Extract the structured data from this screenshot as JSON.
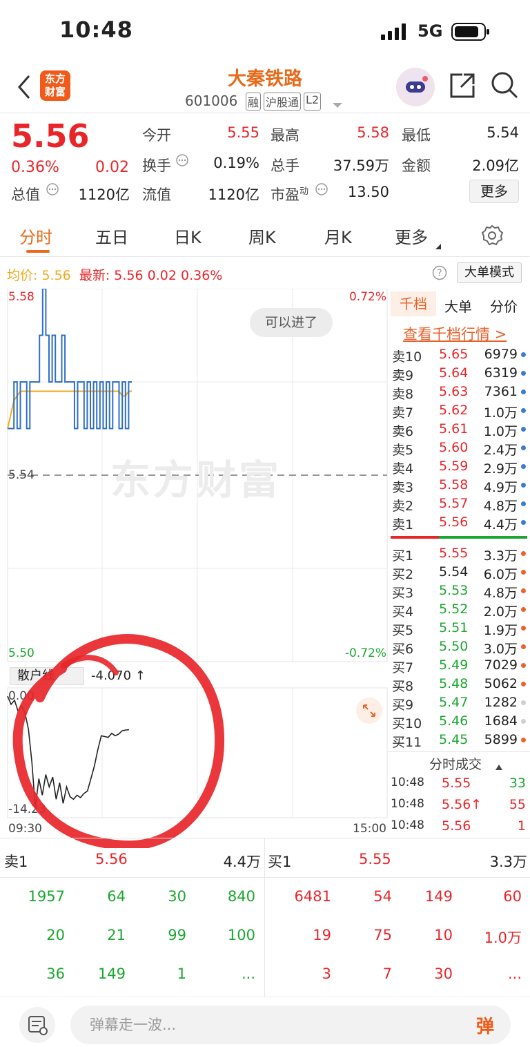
{
  "status": {
    "time": "10:48",
    "network": "5G"
  },
  "header": {
    "title": "大秦铁路",
    "code": "601006",
    "badges": [
      "融",
      "沪股通",
      "L2"
    ],
    "logo_text": "东方财富"
  },
  "quote": {
    "price": "5.56",
    "change_pct": "0.36%",
    "change": "0.02",
    "fields": [
      {
        "label": "今开",
        "value": "5.55"
      },
      {
        "label": "最高",
        "value": "5.58"
      },
      {
        "label": "最低",
        "value": "5.54"
      },
      {
        "label": "换手",
        "value": "0.19%"
      },
      {
        "label": "总手",
        "value": "37.59万"
      },
      {
        "label": "金额",
        "value": "2.09亿"
      },
      {
        "label": "总值",
        "value": "1120亿"
      },
      {
        "label": "流值",
        "value": "1120亿"
      },
      {
        "label": "市盈",
        "label_sup": "动",
        "value": "13.50"
      }
    ],
    "more_button": "更多"
  },
  "tabs": [
    "分时",
    "五日",
    "日K",
    "周K",
    "月K",
    "更多"
  ],
  "infobar": {
    "avg_label": "均价:",
    "avg_value": "5.56",
    "latest_label": "最新:",
    "latest_value": "5.56",
    "latest_change": "0.02",
    "latest_pct": "0.36%",
    "mode_button": "大单模式"
  },
  "chart": {
    "y_top": "5.58",
    "y_mid": "5.54",
    "y_bottom": "5.50",
    "pct_top": "0.72%",
    "pct_bottom": "-0.72%",
    "toast": "可以进了",
    "watermark": "东方财富",
    "sub_label": "散户线",
    "sub_value": "-4.070 ↑",
    "sub_y_top": "0.00",
    "sub_y_bottom": "-14.23",
    "time_start": "09:30",
    "time_end": "15:00",
    "colors": {
      "price_line": "#2f6fc4",
      "avg_line": "#f2a81c",
      "sub_line": "#222222",
      "annotation": "#e8262a"
    }
  },
  "chart_data": {
    "type": "line",
    "title": "",
    "x_range": [
      "09:30",
      "15:00"
    ],
    "ylim": [
      5.5,
      5.58
    ],
    "reference": 5.54,
    "series": [
      {
        "values": [
          5.55,
          5.55,
          5.56,
          5.55,
          5.56,
          5.56,
          5.55,
          5.56,
          5.56,
          5.56,
          5.57,
          5.58,
          5.57,
          5.56,
          5.57,
          5.56,
          5.56,
          5.57,
          5.56,
          5.56,
          5.56,
          5.55,
          5.56,
          5.56,
          5.55,
          5.56,
          5.55,
          5.56,
          5.55,
          5.56,
          5.55,
          5.56,
          5.55,
          5.56,
          5.56,
          5.55,
          5.56,
          5.55,
          5.56,
          5.56
        ]
      },
      {
        "values": [
          5.55,
          5.553,
          5.556,
          5.557,
          5.558,
          5.558,
          5.558,
          5.558,
          5.558,
          5.558,
          5.558,
          5.558,
          5.558,
          5.558,
          5.558,
          5.558,
          5.558,
          5.558,
          5.558,
          5.558,
          5.558,
          5.558,
          5.558,
          5.558,
          5.558,
          5.558,
          5.558,
          5.558,
          5.558,
          5.558,
          5.558,
          5.558,
          5.558,
          5.558,
          5.558,
          5.558,
          5.557,
          5.557,
          5.558,
          5.558
        ]
      }
    ],
    "sub_chart": {
      "ylim": [
        -14.23,
        0.0
      ],
      "values": [
        0.0,
        -1.0,
        -0.5,
        -1.8,
        -1.2,
        -2.0,
        -4.0,
        -8.0,
        -13.5,
        -10.0,
        -12.0,
        -9.5,
        -11.0,
        -9.8,
        -12.5,
        -10.5,
        -13.0,
        -11.0,
        -12.2,
        -12.5,
        -12.0,
        -12.3,
        -11.8,
        -11.5,
        -10.0,
        -8.5,
        -6.5,
        -4.8,
        -4.9,
        -5.0,
        -4.5,
        -4.8,
        -4.6,
        -4.2,
        -4.1,
        -4.07
      ]
    }
  },
  "book": {
    "tabs": [
      "千档",
      "大单",
      "分价"
    ],
    "link": "查看千档行情 >",
    "asks": [
      {
        "label": "卖10",
        "price": "5.65",
        "vol": "6979",
        "dot": "#3a7bd5"
      },
      {
        "label": "卖9",
        "price": "5.64",
        "vol": "6319",
        "dot": "#3a7bd5"
      },
      {
        "label": "卖8",
        "price": "5.63",
        "vol": "7361",
        "dot": "#3a7bd5"
      },
      {
        "label": "卖7",
        "price": "5.62",
        "vol": "1.0万",
        "dot": "#3a7bd5"
      },
      {
        "label": "卖6",
        "price": "5.61",
        "vol": "1.0万",
        "dot": "#3a7bd5"
      },
      {
        "label": "卖5",
        "price": "5.60",
        "vol": "2.4万",
        "dot": "#3a7bd5"
      },
      {
        "label": "卖4",
        "price": "5.59",
        "vol": "2.9万",
        "dot": "#3a7bd5"
      },
      {
        "label": "卖3",
        "price": "5.58",
        "vol": "4.9万",
        "dot": "#3a7bd5"
      },
      {
        "label": "卖2",
        "price": "5.57",
        "vol": "4.8万",
        "dot": "#3a7bd5"
      },
      {
        "label": "卖1",
        "price": "5.56",
        "vol": "4.4万",
        "dot": "#3a7bd5"
      }
    ],
    "bids": [
      {
        "label": "买1",
        "price": "5.55",
        "vol": "3.3万",
        "dot": "#f0602a",
        "pcolor": "#e8262a"
      },
      {
        "label": "买2",
        "price": "5.54",
        "vol": "6.0万",
        "dot": "#f0602a",
        "pcolor": "#222222"
      },
      {
        "label": "买3",
        "price": "5.53",
        "vol": "4.8万",
        "dot": "#f0602a",
        "pcolor": "#1aa72f"
      },
      {
        "label": "买4",
        "price": "5.52",
        "vol": "2.0万",
        "dot": "#f0602a",
        "pcolor": "#1aa72f"
      },
      {
        "label": "买5",
        "price": "5.51",
        "vol": "1.9万",
        "dot": "#f0602a",
        "pcolor": "#1aa72f"
      },
      {
        "label": "买6",
        "price": "5.50",
        "vol": "3.0万",
        "dot": "#f0602a",
        "pcolor": "#1aa72f"
      },
      {
        "label": "买7",
        "price": "5.49",
        "vol": "7029",
        "dot": "#f0602a",
        "pcolor": "#1aa72f"
      },
      {
        "label": "买8",
        "price": "5.48",
        "vol": "5062",
        "dot": "#f0602a",
        "pcolor": "#1aa72f"
      },
      {
        "label": "买9",
        "price": "5.47",
        "vol": "1282",
        "dot": "#cfcfcf",
        "pcolor": "#1aa72f"
      },
      {
        "label": "买10",
        "price": "5.46",
        "vol": "1684",
        "dot": "#cfcfcf",
        "pcolor": "#1aa72f"
      },
      {
        "label": "买11",
        "price": "5.45",
        "vol": "5899",
        "dot": "#f0602a",
        "pcolor": "#1aa72f"
      }
    ],
    "ticks_header": "分时成交",
    "ticks": [
      {
        "time": "10:48",
        "price": "5.55",
        "vol": "33",
        "vcolor": "#1aa72f"
      },
      {
        "time": "10:48",
        "price": "5.56↑",
        "vol": "55",
        "vcolor": "#e8262a"
      },
      {
        "time": "10:48",
        "price": "5.56",
        "vol": "1",
        "vcolor": "#e8262a"
      }
    ]
  },
  "bottom": {
    "sell_label": "卖1",
    "sell_price": "5.56",
    "sell_vol": "4.4万",
    "buy_label": "买1",
    "buy_price": "5.55",
    "buy_vol": "3.3万",
    "sell_grid": [
      [
        "1957",
        "64",
        "30",
        "840"
      ],
      [
        "20",
        "21",
        "99",
        "100"
      ],
      [
        "36",
        "149",
        "1",
        "..."
      ]
    ],
    "buy_grid": [
      [
        "6481",
        "54",
        "149",
        "60"
      ],
      [
        "19",
        "75",
        "10",
        "1.0万"
      ],
      [
        "3",
        "7",
        "30",
        "..."
      ]
    ]
  },
  "input": {
    "placeholder": "弹幕走一波...",
    "danmu_button": "弹"
  }
}
